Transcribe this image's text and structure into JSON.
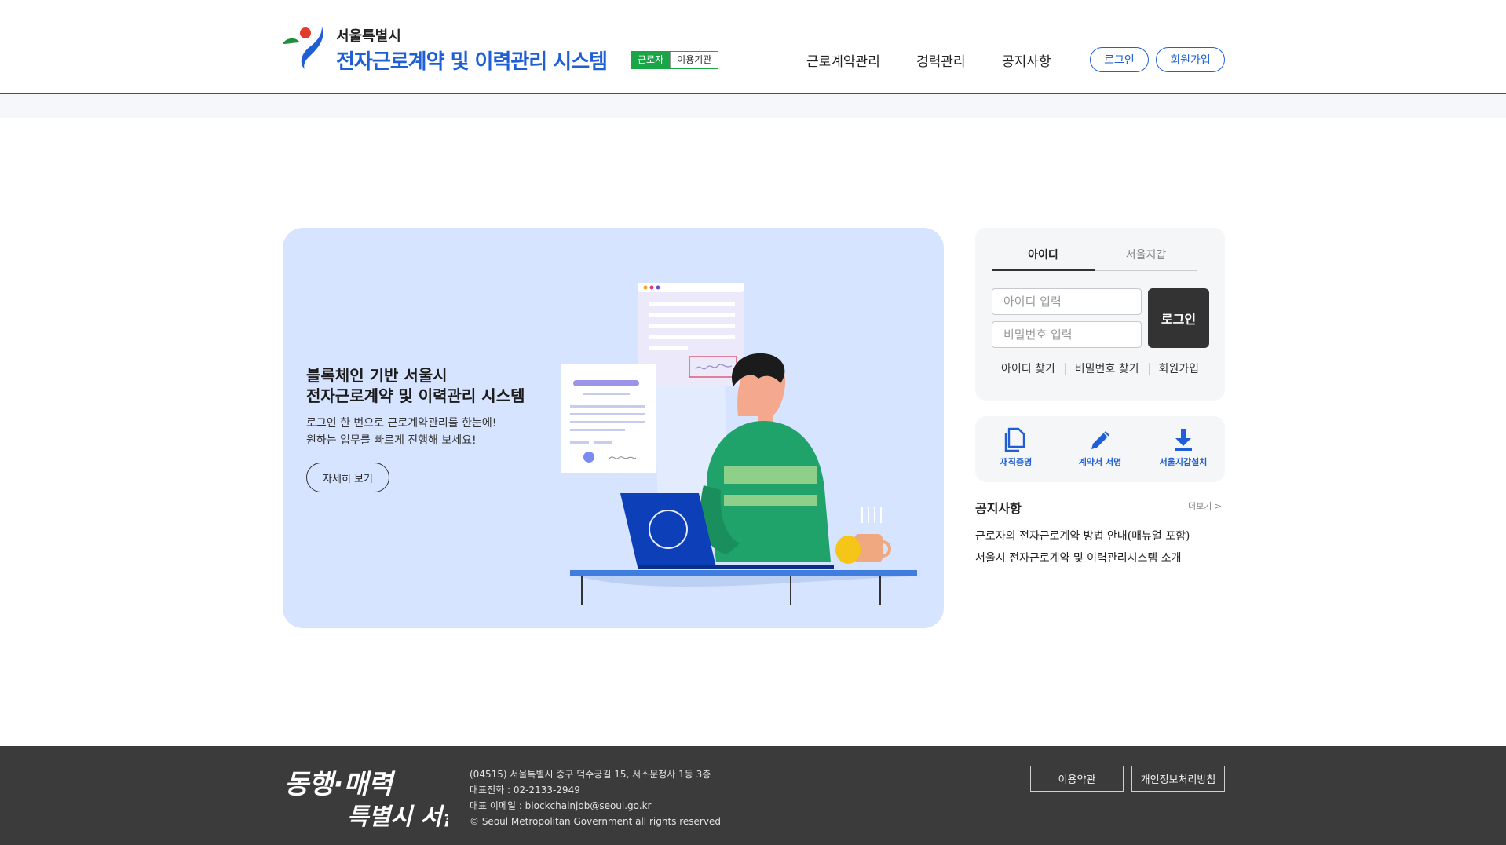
{
  "header": {
    "org_name": "서울특별시",
    "system_title": "전자근로계약 및 이력관리 시스템",
    "mode": {
      "worker": "근로자",
      "agency": "이용기관"
    },
    "nav": [
      "근로계약관리",
      "경력관리",
      "공지사항"
    ],
    "login": "로그인",
    "signup": "회원가입"
  },
  "hero": {
    "title_line1": "블록체인 기반 서울시",
    "title_line2": "전자근로계약 및 이력관리 시스템",
    "desc_line1": "로그인 한 번으로 근로계약관리를 한눈에!",
    "desc_line2": "원하는 업무를 빠르게 진행해 보세요!",
    "more_button": "자세히 보기"
  },
  "login_panel": {
    "tabs": [
      "아이디",
      "서울지갑"
    ],
    "id_placeholder": "아이디 입력",
    "pw_placeholder": "비밀번호 입력",
    "submit": "로그인",
    "links": [
      "아이디 찾기",
      "비밀번호 찾기",
      "회원가입"
    ]
  },
  "quick_menu": [
    {
      "label": "재직증명",
      "icon": "document-copy-icon"
    },
    {
      "label": "계약서 서명",
      "icon": "pencil-icon"
    },
    {
      "label": "서울지갑설치",
      "icon": "download-icon"
    }
  ],
  "notice": {
    "title": "공지사항",
    "more": "더보기 >",
    "items": [
      "근로자의 전자근로계약 방법 안내(매뉴얼 포함)",
      "서울시 전자근로계약 및 이력관리시스템 소개"
    ]
  },
  "footer": {
    "address": "(04515) 서울특별시 중구 덕수궁길 15, 서소문청사 1동 3층",
    "phone": "대표전화 : 02-2133-2949",
    "email": "대표 이메일 : blockchainjob@seoul.go.kr",
    "copyright": "© Seoul Metropolitan Government all rights reserved",
    "terms": "이용약관",
    "privacy": "개인정보처리방침",
    "slogan_line1": "동행·매력",
    "slogan_line2": "특별시 서울"
  },
  "colors": {
    "brand_blue": "#1f5fd6",
    "worker_green": "#1aa546",
    "hero_bg": "#d7e4ff",
    "footer_bg": "#3b3b3b"
  }
}
